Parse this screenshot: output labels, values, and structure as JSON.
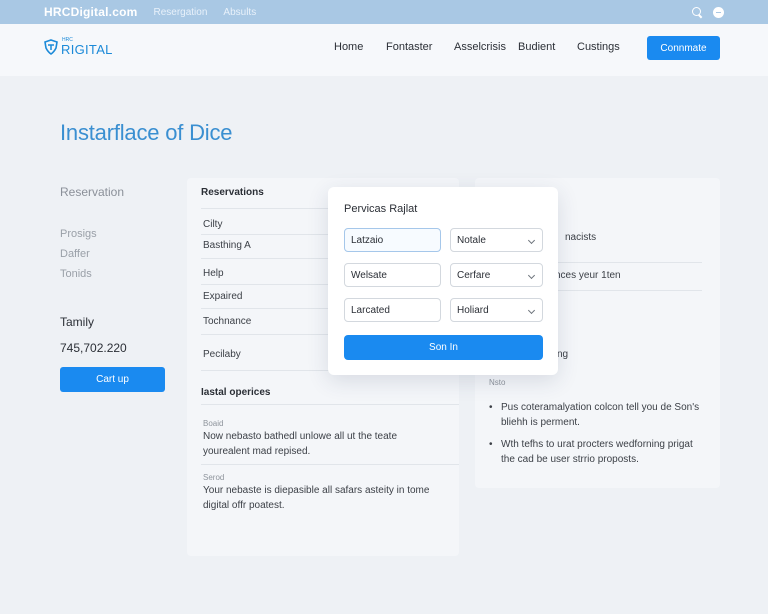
{
  "topbar": {
    "domain": "HRCDigital.com",
    "links": [
      "Resergation",
      "Absults"
    ],
    "icons": [
      "search-icon",
      "account-icon"
    ]
  },
  "header": {
    "logo_small": "HRC",
    "logo_big": "RIGITAL",
    "nav": [
      "Home",
      "Fontaster",
      "Asselcrisis",
      "Budient",
      "Custings"
    ],
    "cta_label": "Connmate"
  },
  "page_title": "Instarflace of Dice",
  "left": {
    "reservation_title": "Reservation",
    "items": [
      "Prosigs",
      "Daffer",
      "Tonids"
    ],
    "total_label": "Tamily",
    "total_value": "745,702.220",
    "cta_label": "Cart up"
  },
  "middle": {
    "section_title": "Reservations",
    "rows": [
      "Cilty",
      "Basthing A",
      "Help",
      "Expaired",
      "Tochnance",
      "Pecilaby"
    ],
    "services_title": "Iastal operices",
    "services": [
      {
        "small": "Boaid",
        "text": "Now nebasto bathedl unlowe all ut the teate yourealent mad repised."
      },
      {
        "small": "Serod",
        "text": "Your nebaste is diepasible all safars asteity in tome digital offr poatest."
      }
    ]
  },
  "right": {
    "row1": "nacists",
    "row2": "nces yeur 1ten",
    "row3": "ng",
    "small": "Nsto",
    "bullets": [
      "Pus coteramalyation colcon tell you de Son's bliehh is perment.",
      "Wth tefhs to urat procters wedforning prigat the cad be user strrio proposts."
    ]
  },
  "modal": {
    "title": "Pervicas Rajlat",
    "fields": [
      {
        "left": "Latzaio",
        "right": "Notale"
      },
      {
        "left": "Welsate",
        "right": "Cerfare"
      },
      {
        "left": "Larcated",
        "right": "Holiard"
      }
    ],
    "submit_label": "Son In"
  },
  "colors": {
    "accent": "#1a8af0",
    "topbar": "#a9c8e4",
    "title": "#3a8fd1",
    "background": "#eef1f5"
  }
}
